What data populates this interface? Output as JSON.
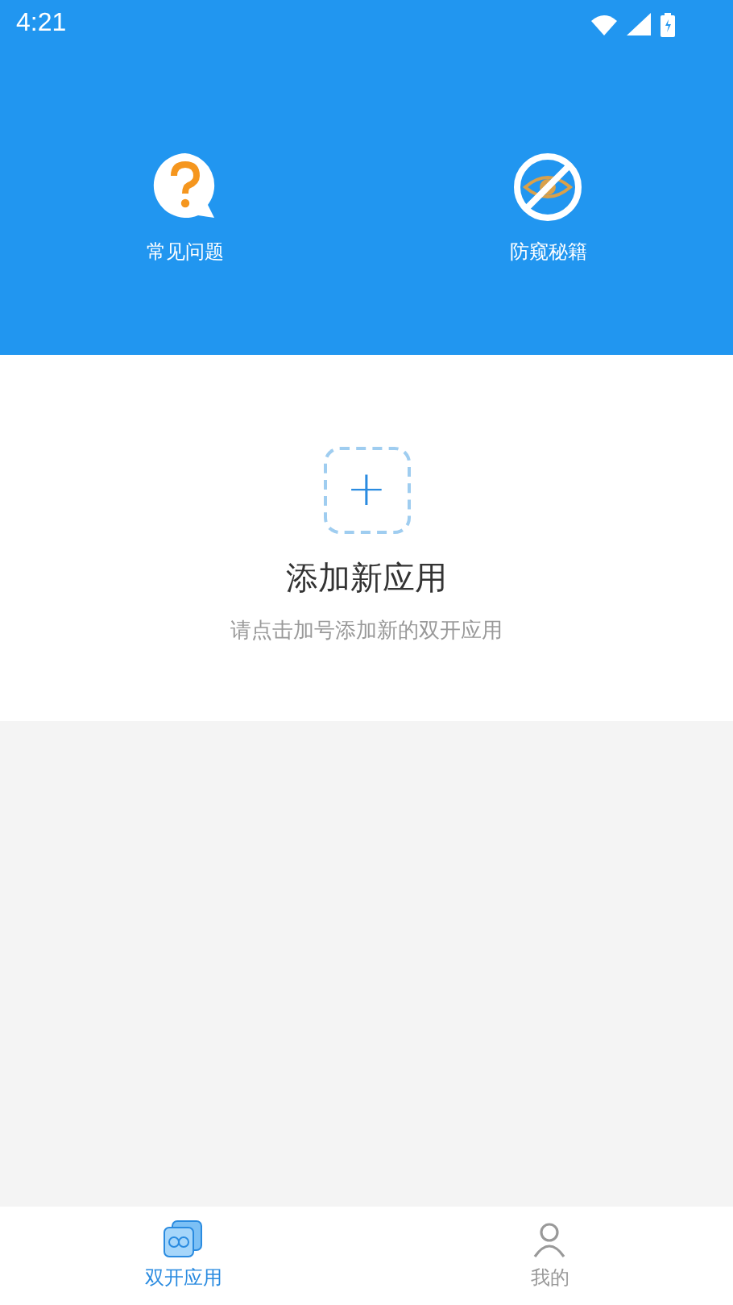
{
  "status_bar": {
    "time": "4:21"
  },
  "shortcuts": [
    {
      "kind": "faq",
      "label": "常见问题"
    },
    {
      "kind": "privacy",
      "label": "防窥秘籍"
    }
  ],
  "empty_state": {
    "button": "+",
    "title": "添加新应用",
    "hint": "请点击加号添加新的双开应用"
  },
  "tabs": [
    {
      "kind": "apps",
      "label": "双开应用",
      "selected": true
    },
    {
      "kind": "me",
      "label": "我的",
      "selected": false
    }
  ]
}
